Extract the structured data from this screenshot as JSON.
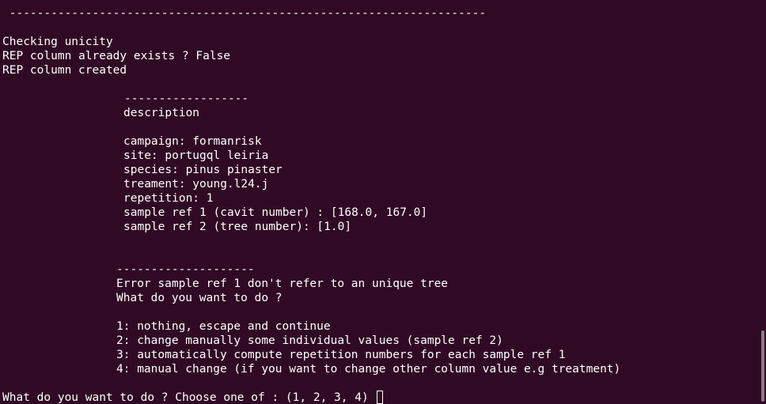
{
  "terminal": {
    "colors": {
      "background": "#300a24",
      "foreground": "#ffffff"
    },
    "lines": {
      "top_separator": " ---------------------------------------------------------------------",
      "checking": "Checking unicity",
      "rep_exists": "REP column already exists ? False",
      "rep_created": "REP column created",
      "desc_separator": "------------------",
      "desc_title": "description",
      "campaign": "campaign: formanrisk",
      "site": "site: portugql leiria",
      "species": "species: pinus pinaster",
      "treatment": "treament: young.l24.j",
      "repetition": "repetition: 1",
      "sample_ref_1": "sample ref 1 (cavit number) : [168.0, 167.0]",
      "sample_ref_2": "sample ref 2 (tree number): [1.0]",
      "error_separator": "--------------------",
      "error_msg": "Error sample ref 1 don't refer to an unique tree",
      "question": "What do you want to do ?",
      "option_1": "1: nothing, escape and continue",
      "option_2": "2: change manually some individual values (sample ref 2)",
      "option_3": "3: automatically compute repetition numbers for each sample ref 1",
      "option_4": "4: manual change (if you want to change other column value e.g treatment)",
      "prompt": "What do you want to do ? Choose one of : (1, 2, 3, 4)"
    }
  }
}
